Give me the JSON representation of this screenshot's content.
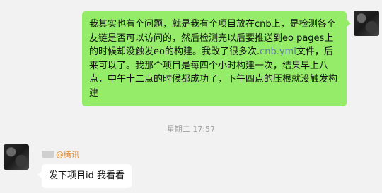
{
  "messages": {
    "me": {
      "text_1": "我其实也有个问题，就是我有个项目放在cnb上，是检测各个友链是否可以访问的，然后检测完以后要推送到eo pages上的时候却没触发eo的构建。我改了很多次.",
      "link": "cnb.yml",
      "text_2": "文件，后来可以了。我那个项目是每四个小时构建一次，结果早上八点，中午十二点的时候都成功了，下午四点的压根就没触发构建"
    },
    "timestamp": "星期二 17:57",
    "them": {
      "org_prefix": "@",
      "org": "腾讯",
      "text": "发下项目id 我看看"
    }
  }
}
